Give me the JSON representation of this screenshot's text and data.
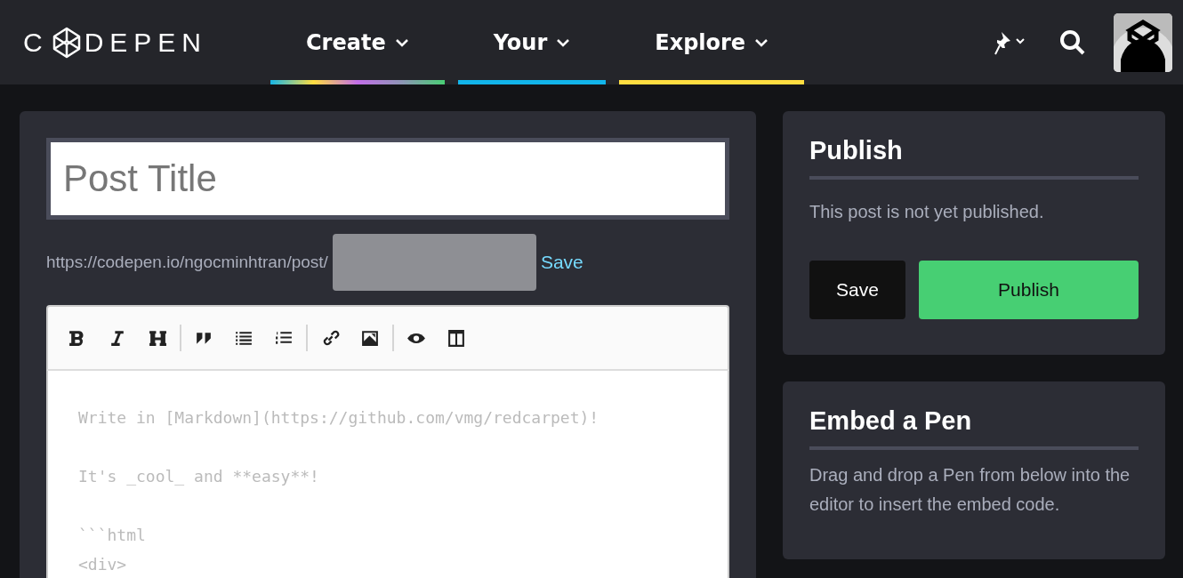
{
  "header": {
    "logo": {
      "left": "C",
      "right": "DEPEN"
    },
    "nav": [
      {
        "label": "Create",
        "kind": "rainbow"
      },
      {
        "label": "Your",
        "kind": "solid",
        "color": "#12b5ea"
      },
      {
        "label": "Explore",
        "kind": "solid",
        "color": "#ffdd40"
      }
    ]
  },
  "editor": {
    "title_placeholder": "Post Title",
    "url_prefix": "https://codepen.io/ngocminhtran/post/",
    "slug_save": "Save",
    "toolbar": [
      [
        {
          "kind": "bold"
        },
        {
          "kind": "italic"
        },
        {
          "kind": "heading"
        }
      ],
      [
        {
          "kind": "quote"
        },
        {
          "kind": "bullet-list"
        },
        {
          "kind": "numbered-list"
        }
      ],
      [
        {
          "kind": "link"
        },
        {
          "kind": "image"
        }
      ],
      [
        {
          "kind": "preview"
        },
        {
          "kind": "side-by-side"
        }
      ]
    ],
    "body_placeholder": [
      "Write in [Markdown](https://github.com/vmg/redcarpet)!",
      "It's _cool_ and **easy**!",
      "```html\n<div>"
    ]
  },
  "publish": {
    "title": "Publish",
    "status": "This post is not yet published.",
    "buttons": [
      {
        "label": "Save",
        "kind": "secondary"
      },
      {
        "label": "Publish",
        "kind": "primary"
      }
    ]
  },
  "embed": {
    "title": "Embed a Pen",
    "text": "Drag and drop a Pen from below into the editor to insert the embed code."
  }
}
